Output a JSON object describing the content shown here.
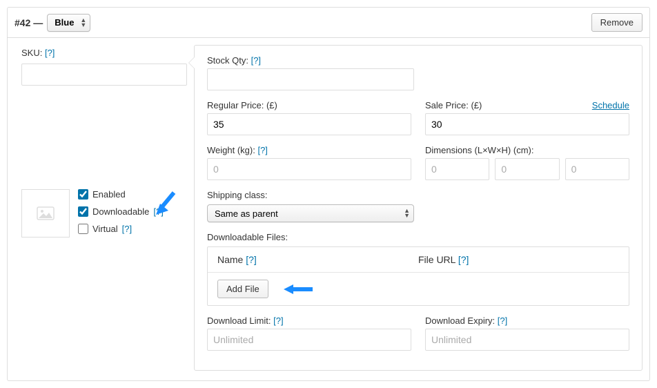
{
  "header": {
    "variation_id": "#42",
    "attribute_value": "Blue",
    "remove_btn": "Remove"
  },
  "left": {
    "sku_label": "SKU:",
    "sku_value": "",
    "enabled_label": "Enabled",
    "enabled_checked": true,
    "downloadable_label": "Downloadable",
    "downloadable_checked": true,
    "virtual_label": "Virtual",
    "virtual_checked": false
  },
  "right": {
    "stock_label": "Stock Qty:",
    "stock_value": "",
    "regular_price_label": "Regular Price: (£)",
    "regular_price_value": "35",
    "sale_price_label": "Sale Price: (£)",
    "sale_price_value": "30",
    "schedule_link": "Schedule",
    "weight_label": "Weight (kg):",
    "weight_placeholder": "0",
    "dimensions_label": "Dimensions (L×W×H) (cm):",
    "dim_l_placeholder": "0",
    "dim_w_placeholder": "0",
    "dim_h_placeholder": "0",
    "shipping_label": "Shipping class:",
    "shipping_value": "Same as parent",
    "dl_files_label": "Downloadable Files:",
    "dl_col_name": "Name",
    "dl_col_url": "File URL",
    "add_file_btn": "Add File",
    "dl_limit_label": "Download Limit:",
    "dl_limit_placeholder": "Unlimited",
    "dl_expiry_label": "Download Expiry:",
    "dl_expiry_placeholder": "Unlimited"
  },
  "help_glyph": "[?]"
}
